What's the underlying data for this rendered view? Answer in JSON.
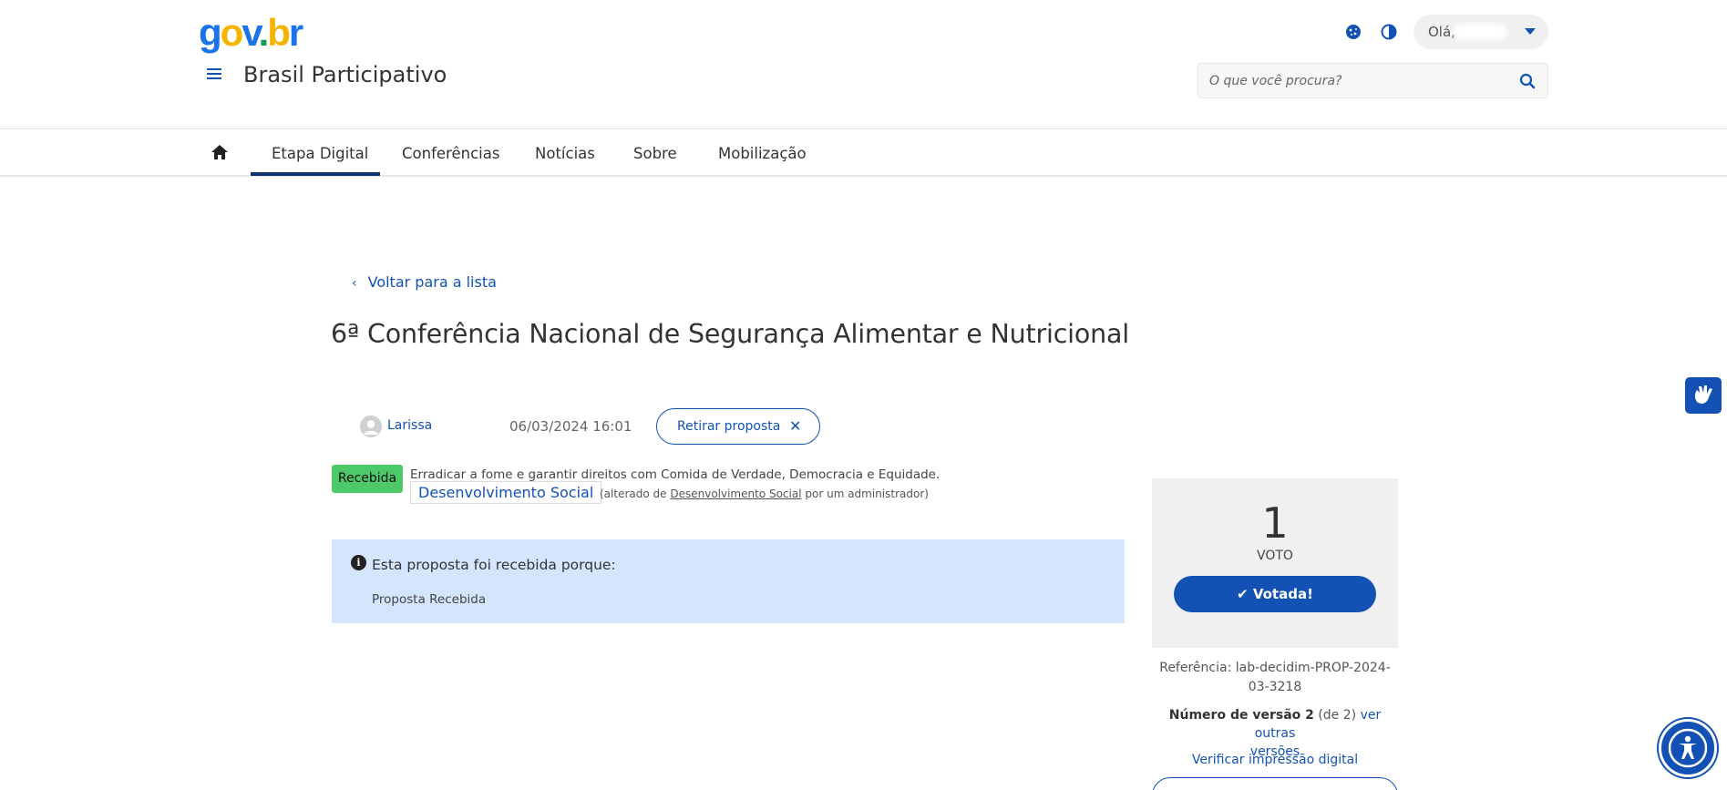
{
  "header": {
    "logo": {
      "g": "g",
      "o": "o",
      "v": "v",
      "dot": ".",
      "b": "b",
      "r": "r"
    },
    "site_title": "Brasil Participativo",
    "greeting": "Olá,",
    "search_placeholder": "O que você procura?",
    "icons": [
      "cookie-icon",
      "contrast-icon",
      "search-icon",
      "menu-icon"
    ]
  },
  "nav": {
    "tabs": [
      {
        "label": "Etapa Digital",
        "active": true
      },
      {
        "label": "Conferências"
      },
      {
        "label": "Notícias"
      },
      {
        "label": "Sobre"
      },
      {
        "label": "Mobilização"
      }
    ]
  },
  "proposal": {
    "back_label": "Voltar para a lista",
    "title": "6ª Conferência Nacional de Segurança Alimentar e Nutricional",
    "author": "Larissa",
    "date": "06/03/2024 16:01",
    "withdraw_label": "Retirar proposta",
    "status_badge": "Recebida",
    "description": "Erradicar a fome e garantir direitos com Comida de Verdade, Democracia e Equidade.",
    "tag": "Desenvolvimento Social",
    "altered_prefix": "(alterado de",
    "altered_link": "Desenvolvimento Social",
    "altered_suffix": "por um administrador)",
    "info_title": "Esta proposta foi recebida porque:",
    "info_text": "Proposta Recebida"
  },
  "votes": {
    "count": "1",
    "label": "VOTO",
    "voted_label": "✔ Votada!"
  },
  "meta": {
    "reference_line1": "Referência: lab-decidim-PROP-2024-",
    "reference_line2": "03-3218",
    "version_bold": "Número de versão 2",
    "version_of": "(de 2)",
    "version_link1": "ver outras",
    "version_link2": "versões",
    "verify_label": "Verificar impressão digital"
  },
  "colors": {
    "primary": "#1351b4",
    "nav_active": "#0c326f",
    "badge_green": "#4ec96a",
    "info_bg": "#d4e5fd",
    "panel_bg": "#f0f0f0"
  }
}
